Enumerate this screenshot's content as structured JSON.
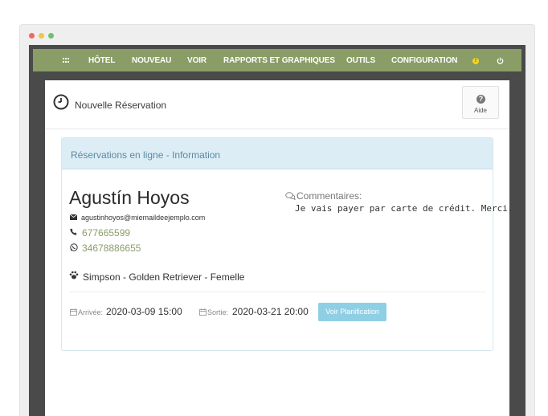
{
  "window": {
    "dots": [
      "#ef6b5c",
      "#f2c44e",
      "#6ec26c"
    ]
  },
  "navbar": {
    "items": [
      "HÔTEL",
      "NOUVEAU",
      "VOIR",
      "RAPPORTS ET GRAPHIQUES",
      "OUTILS",
      "CONFIGURATION"
    ],
    "alert_symbol": "!",
    "color": "#8a9d67"
  },
  "page": {
    "title": "Nouvelle Réservation",
    "help_label": "Aide",
    "help_symbol": "?"
  },
  "panel": {
    "title": "Réservations en ligne - Information"
  },
  "guest": {
    "name": "Agustín Hoyos",
    "email": "agustinhoyos@miemaildeejemplo.com",
    "phone": "677665599",
    "whatsapp": "34678886655",
    "pet": "Simpson - Golden Retriever - Femelle"
  },
  "comments": {
    "label": "Commentaires:",
    "text": "Je vais payer par carte de crédit. Merci."
  },
  "stay": {
    "arrival_label": "Arrivée:",
    "arrival_value": "2020-03-09 15:00",
    "departure_label": "Sortie:",
    "departure_value": "2020-03-21 20:00",
    "plan_button": "Voir Planification"
  }
}
